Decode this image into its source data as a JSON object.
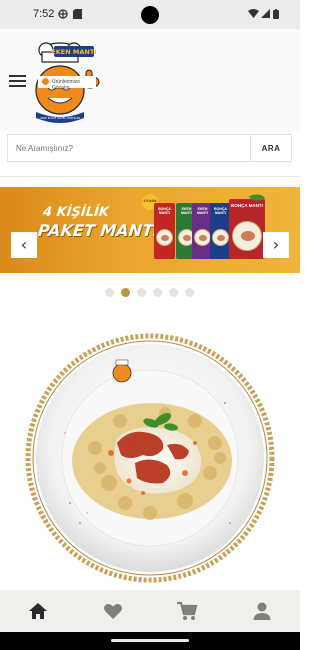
{
  "status_bar": {
    "time": "7:52",
    "icons": [
      "vpn-icon",
      "sd-card-icon",
      "wifi-icon",
      "signal-icon",
      "battery-icon"
    ]
  },
  "header": {
    "menu_icon": "hamburger-menu-icon",
    "logo_text": "EKEN MANTI",
    "logo_subtext": "ANNE ELİYLE GÜZEL YEMEKLER"
  },
  "search": {
    "placeholder": "Ne Aramıştınız?",
    "button_label": "ARA"
  },
  "banner": {
    "title_line1": "4 KİŞİLİK",
    "title_line2": "PAKET MANTI",
    "badge_text": "4 Kişilik",
    "brand_tag": "Ürünlerimize Gözatın",
    "packages": [
      "BOHÇA MANTI",
      "EKEN MANTI",
      "EKEN MANTI",
      "BOHÇA MANTI",
      "BOHÇA MANTI"
    ],
    "arrows": {
      "prev": "‹",
      "next": "›"
    }
  },
  "carousel": {
    "slide_count": 6,
    "active_index": 1
  },
  "product_image": {
    "icon": "manti-plate-image"
  },
  "bottom_nav": {
    "items": [
      "home-icon",
      "heart-icon",
      "cart-icon",
      "account-icon"
    ],
    "active": "home-icon"
  },
  "colors": {
    "banner_orange": "#e9a42d",
    "active_dot": "#b89a3e",
    "nav_bg": "#eef0ea",
    "rope": "#c9a25a"
  }
}
